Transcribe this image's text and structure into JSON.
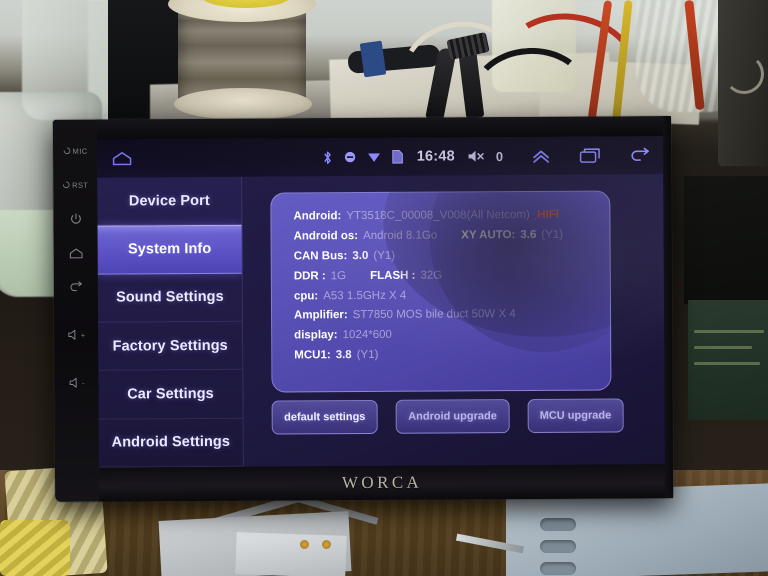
{
  "device": {
    "brand": "WORCA",
    "bezel_buttons": [
      {
        "name": "mic",
        "label": "MIC",
        "icon": "power-circle-icon"
      },
      {
        "name": "reset",
        "label": "RST",
        "icon": "power-circle-icon"
      },
      {
        "name": "power",
        "label": "",
        "icon": "power-icon"
      },
      {
        "name": "home",
        "label": "",
        "icon": "home-icon"
      },
      {
        "name": "back",
        "label": "",
        "icon": "back-arrow-icon"
      },
      {
        "name": "volume-up",
        "label": "+",
        "icon": "speaker-icon"
      },
      {
        "name": "volume-down",
        "label": "-",
        "icon": "speaker-icon"
      }
    ]
  },
  "statusbar": {
    "home_icon": "home-icon",
    "icons": [
      "bluetooth-icon",
      "dnd-icon",
      "wifi-icon",
      "sim-card-icon"
    ],
    "time": "16:48",
    "mute_icon": "volume-mute-icon",
    "volume": "0",
    "nav": [
      "chevron-up-icon",
      "recents-icon",
      "back-arrow-icon"
    ]
  },
  "sidebar": {
    "items": [
      {
        "label": "Device Port",
        "active": false
      },
      {
        "label": "System Info",
        "active": true
      },
      {
        "label": "Sound Settings",
        "active": false
      },
      {
        "label": "Factory Settings",
        "active": false
      },
      {
        "label": "Car Settings",
        "active": false
      },
      {
        "label": "Android Settings",
        "active": false
      }
    ]
  },
  "info": {
    "rows": [
      {
        "key": "Android:",
        "parts": [
          {
            "text": "YT3518C_00008_V008(All Netcom)",
            "style": "dim"
          },
          {
            "text": "_HIFI",
            "style": "hifi"
          }
        ]
      },
      {
        "key": "Android os:",
        "parts": [
          {
            "text": "Android 8.1Go",
            "style": "dim"
          },
          {
            "text": "XY AUTO:",
            "style": "key"
          },
          {
            "text": "3.6",
            "style": "bright"
          },
          {
            "text": "(Y1)",
            "style": "dim"
          }
        ]
      },
      {
        "key": "CAN Bus:",
        "parts": [
          {
            "text": "3.0",
            "style": "bright"
          },
          {
            "text": "(Y1)",
            "style": "dim"
          }
        ]
      },
      {
        "key": "DDR :",
        "parts": [
          {
            "text": "1G",
            "style": "dim"
          },
          {
            "text": "FLASH :",
            "style": "key"
          },
          {
            "text": "32G",
            "style": "dim"
          }
        ]
      },
      {
        "key": "cpu:",
        "parts": [
          {
            "text": "A53 1.5GHz X 4",
            "style": "dim"
          }
        ]
      },
      {
        "key": "Amplifier:",
        "parts": [
          {
            "text": "ST7850 MOS bile duct 50W X 4",
            "style": "dim"
          }
        ]
      },
      {
        "key": "display:",
        "parts": [
          {
            "text": "1024*600",
            "style": "dim"
          }
        ]
      },
      {
        "key": "MCU1:",
        "parts": [
          {
            "text": "3.8",
            "style": "bright"
          },
          {
            "text": "(Y1)",
            "style": "dim"
          }
        ]
      }
    ]
  },
  "buttons": [
    {
      "label": "default settings",
      "dim": false
    },
    {
      "label": "Android upgrade",
      "dim": true
    },
    {
      "label": "MCU upgrade",
      "dim": true
    }
  ],
  "colors": {
    "accent_highlight": "#5b51c4",
    "screen_bg": "#201a42",
    "card_bg": "#6a62ce",
    "hifi_orange": "#e8622a",
    "status_icon": "#8b86ff"
  }
}
